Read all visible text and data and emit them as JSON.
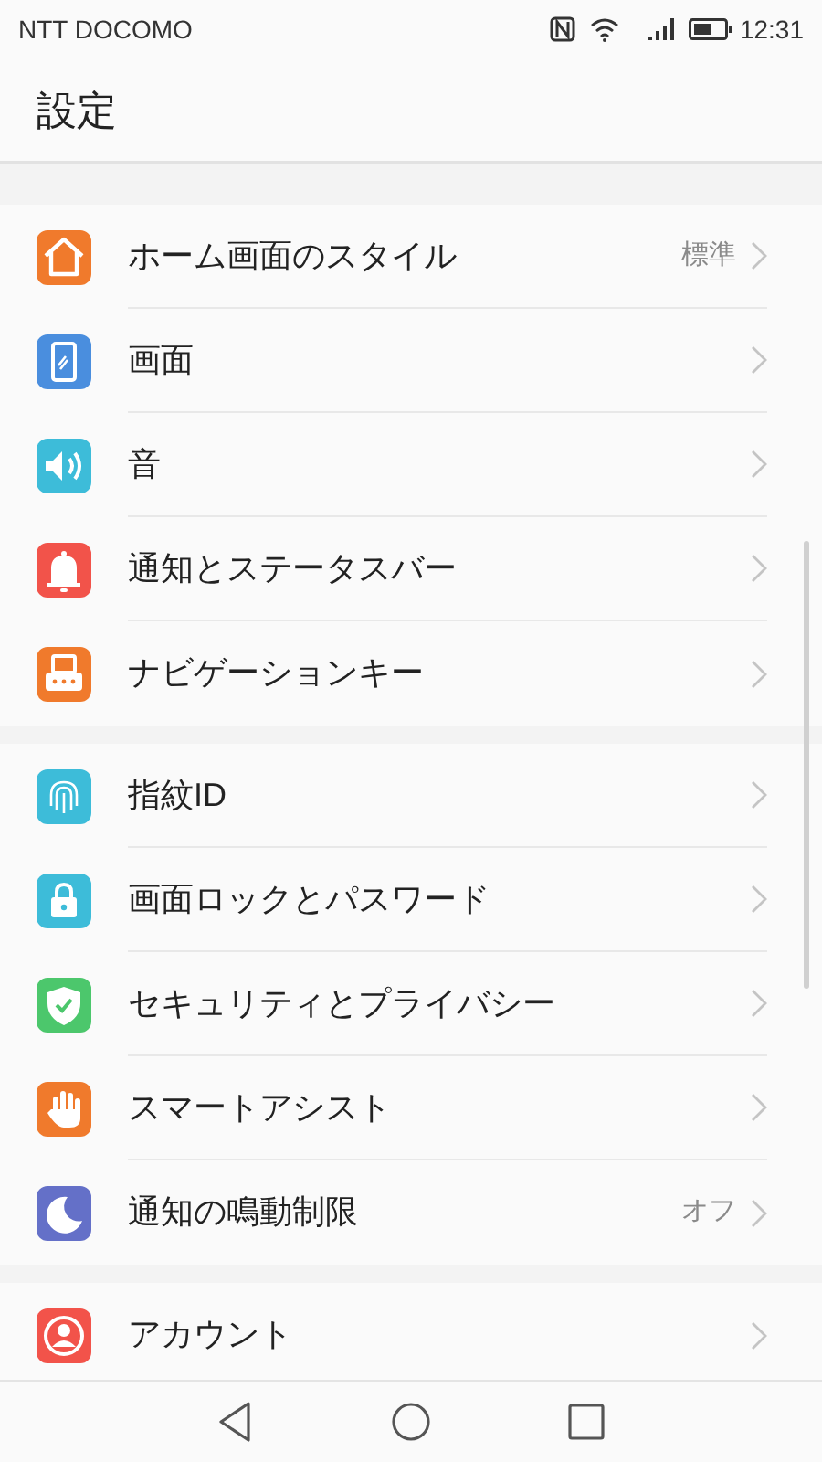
{
  "status_bar": {
    "carrier": "NTT DOCOMO",
    "time": "12:31"
  },
  "title": "設定",
  "sections": [
    {
      "items": [
        {
          "label": "ホーム画面のスタイル",
          "value": "標準",
          "kind": "home",
          "color": "#f07a2c"
        },
        {
          "label": "画面",
          "kind": "display",
          "color": "#4a8ede"
        },
        {
          "label": "音",
          "kind": "sound",
          "color": "#3dbcd9"
        },
        {
          "label": "通知とステータスバー",
          "kind": "bell",
          "color": "#f2534a"
        },
        {
          "label": "ナビゲーションキー",
          "kind": "navkey",
          "color": "#f07a2c"
        }
      ]
    },
    {
      "items": [
        {
          "label": "指紋ID",
          "kind": "fingerprint",
          "color": "#3dbcd9"
        },
        {
          "label": "画面ロックとパスワード",
          "kind": "lock",
          "color": "#3dbcd9"
        },
        {
          "label": "セキュリティとプライバシー",
          "kind": "shield",
          "color": "#4cc76c"
        },
        {
          "label": "スマートアシスト",
          "kind": "hand",
          "color": "#f07a2c"
        },
        {
          "label": "通知の鳴動制限",
          "value": "オフ",
          "kind": "moon",
          "color": "#6470c8"
        }
      ]
    },
    {
      "items": [
        {
          "label": "アカウント",
          "kind": "account",
          "color": "#f2534a"
        }
      ]
    }
  ]
}
